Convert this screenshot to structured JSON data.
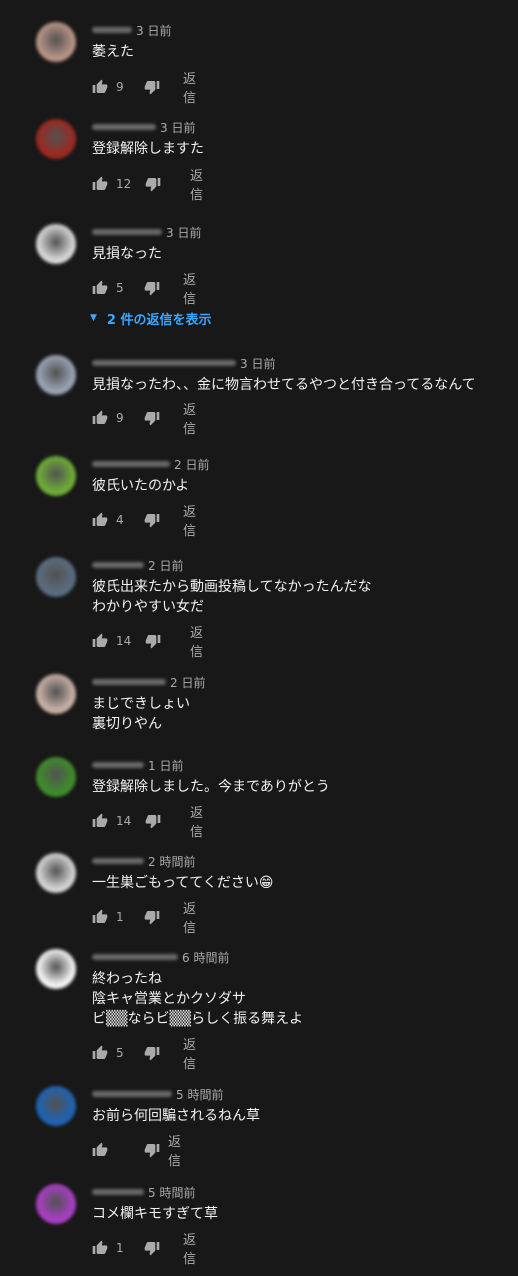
{
  "reply_label": "返信",
  "replies_toggle": "2 件の返信を表示",
  "comments": [
    {
      "time": "3 日前",
      "text": "萎えた",
      "likes": "9",
      "avatar_color": "#b89485"
    },
    {
      "time": "3 日前",
      "text": "登録解除しますた",
      "likes": "12",
      "avatar_color": "#9b2a22"
    },
    {
      "time": "3 日前",
      "text": "見損なった",
      "likes": "5",
      "avatar_color": "#d8d8d8"
    },
    {
      "time": "3 日前",
      "text": "見損なったわ、、金に物言わせてるやつと付き合ってるなんて",
      "likes": "9",
      "avatar_color": "#9aa3b5"
    },
    {
      "time": "2 日前",
      "text": "彼氏いたのかよ",
      "likes": "4",
      "avatar_color": "#6fae38"
    },
    {
      "time": "2 日前",
      "text": "彼氏出来たから動画投稿してなかったんだな\nわかりやすい女だ",
      "likes": "14",
      "avatar_color": "#5a6d80"
    },
    {
      "time": "2 日前",
      "text": "まじできしょい\n裏切りやん",
      "likes": "",
      "avatar_color": "#c9b0a6"
    },
    {
      "time": "1 日前",
      "text": "登録解除しました。今までありがとう",
      "likes": "14",
      "avatar_color": "#3f8c2a"
    },
    {
      "time": "2 時間前",
      "text": "一生巣ごもっててください",
      "emoji": "😁",
      "likes": "1",
      "avatar_color": "#d5d5d5"
    },
    {
      "time": "6 時間前",
      "text": "終わったね\n陰キャ営業とかクソダサ\nビ▒▒ならビ▒▒らしく振る舞えよ",
      "likes": "5",
      "avatar_color": "#f4f4f4"
    },
    {
      "time": "5 時間前",
      "text": "お前ら何回騙されるねん草",
      "likes": "",
      "avatar_color": "#1f63b4"
    },
    {
      "time": "5 時間前",
      "text": "コメ欄キモすぎて草",
      "likes": "1",
      "avatar_color": "#a93fc4"
    }
  ]
}
